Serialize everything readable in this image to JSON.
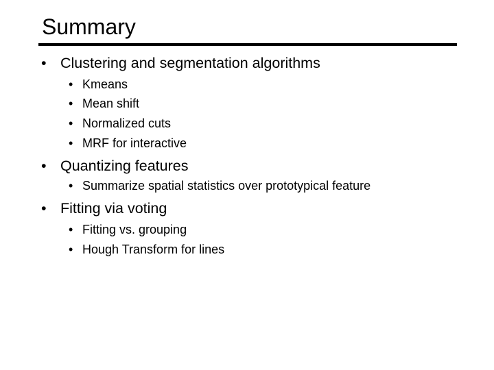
{
  "slide": {
    "title": "Summary",
    "bullet_glyph": "•",
    "sections": [
      {
        "label": "Clustering and segmentation algorithms",
        "items": [
          "Kmeans",
          "Mean shift",
          "Normalized cuts",
          "MRF for interactive"
        ]
      },
      {
        "label": "Quantizing features",
        "items": [
          "Summarize spatial statistics over prototypical feature"
        ]
      },
      {
        "label": "Fitting via voting",
        "items": [
          "Fitting vs. grouping",
          "Hough Transform for lines"
        ]
      }
    ]
  }
}
